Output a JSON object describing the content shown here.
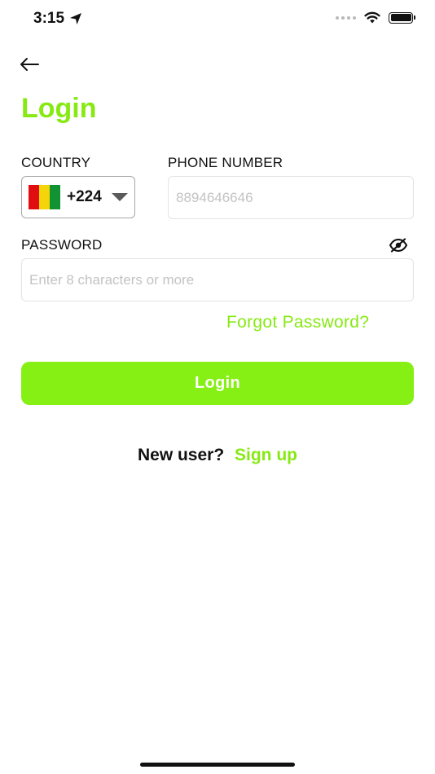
{
  "status_bar": {
    "time": "3:15",
    "icons": [
      "location-arrow-icon",
      "cellular-signal-icon",
      "wifi-icon",
      "battery-icon"
    ]
  },
  "header": {
    "back_icon": "arrow-left-icon"
  },
  "page": {
    "title": "Login"
  },
  "form": {
    "country_label": "COUNTRY",
    "phone_label": "PHONE NUMBER",
    "password_label": "PASSWORD",
    "country": {
      "dial_code": "+224",
      "flag_colors": [
        "#e00d11",
        "#f5d50a",
        "#119233"
      ]
    },
    "phone_placeholder": "8894646646",
    "password_placeholder": "Enter 8 characters or more",
    "password_toggle_icon": "eye-slash-icon",
    "forgot_password": "Forgot Password?"
  },
  "actions": {
    "login_label": "Login",
    "signup_prompt": "New user?",
    "signup_link": "Sign up"
  },
  "colors": {
    "accent": "#86ea12",
    "button": "#86ef14"
  }
}
